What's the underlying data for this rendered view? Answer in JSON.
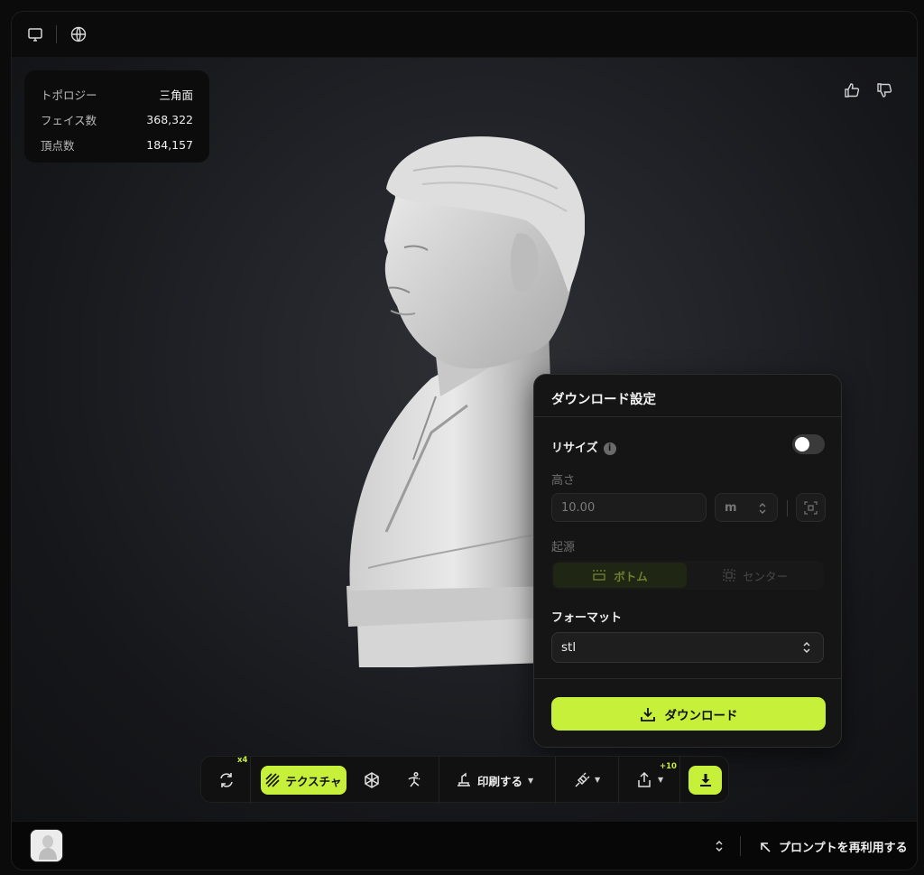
{
  "topbar": {
    "icons": [
      "monitor-icon",
      "globe-icon"
    ]
  },
  "stats": {
    "rows": [
      {
        "key": "トポロジー",
        "value": "三角面"
      },
      {
        "key": "フェイス数",
        "value": "368,322"
      },
      {
        "key": "頂点数",
        "value": "184,157"
      }
    ]
  },
  "feedback": {
    "icons": [
      "thumbs-up-icon",
      "thumbs-down-icon"
    ]
  },
  "download_panel": {
    "title": "ダウンロード設定",
    "resize_label": "リサイズ",
    "resize_enabled": false,
    "height_label": "高さ",
    "height_value": "10.00",
    "unit_value": "m",
    "origin_label": "起源",
    "origin_options": [
      "ボトム",
      "センター"
    ],
    "origin_selected": "ボトム",
    "format_label": "フォーマット",
    "format_value": "stl",
    "download_label": "ダウンロード"
  },
  "toolbar": {
    "regenerate_badge": "x4",
    "texture_label": "テクスチャ",
    "print_label": "印刷する",
    "share_badge": "+10",
    "accent_color": "#c7f03a"
  },
  "bottombar": {
    "reuse_label": "プロンプトを再利用する"
  }
}
